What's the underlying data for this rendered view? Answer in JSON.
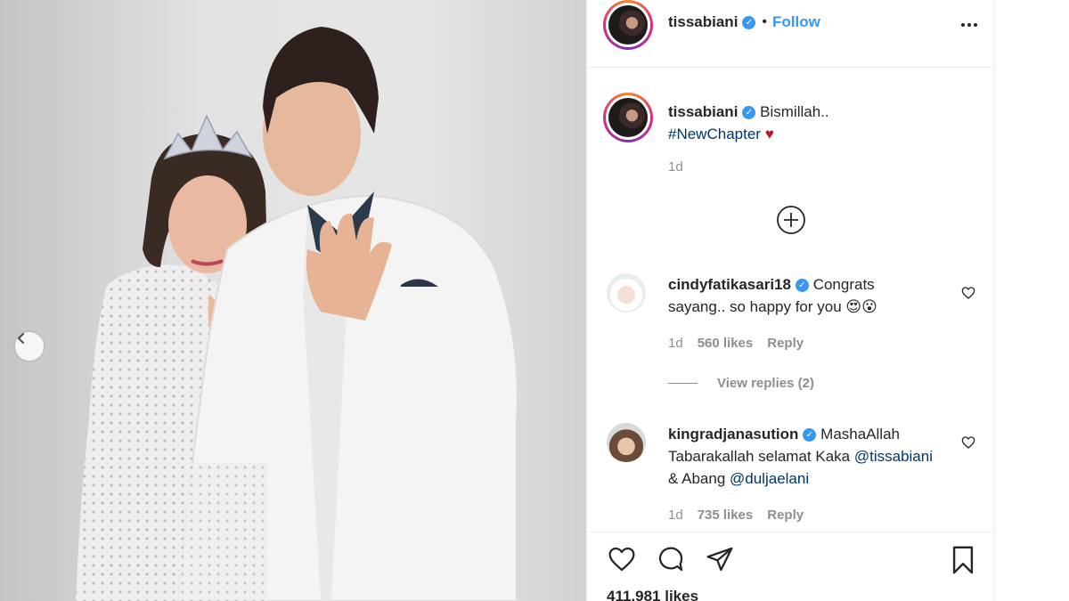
{
  "post": {
    "username": "tissabiani",
    "verified_mark": "✓",
    "separator": "•",
    "follow_label": "Follow",
    "caption_text": "Bismillah..",
    "caption_hashtag": "#NewChapter",
    "caption_emoji": "♥",
    "caption_time": "1d",
    "likes_total": "411,981 likes"
  },
  "comments": [
    {
      "username": "cindyfatikasari18",
      "text_line": "Congrats sayang.. so happy for you",
      "emoji": "😍😮",
      "time": "1d",
      "likes": "560 likes",
      "reply_label": "Reply",
      "view_replies": "View replies (2)"
    },
    {
      "username": "kingradjanasution",
      "text_part1": "MashaAllah Tabarakallah selamat Kaka",
      "mention1": "@tissabiani",
      "and_text": "& Abang",
      "mention2": "@duljaelani",
      "time": "1d",
      "likes": "735 likes",
      "reply_label": "Reply"
    }
  ],
  "icons": {
    "more": "more-options-icon",
    "load_more": "plus-circle-icon",
    "like": "heart-icon",
    "comment": "comment-icon",
    "share": "send-icon",
    "save": "bookmark-icon",
    "carousel_prev": "chevron-left-icon"
  },
  "colors": {
    "link_blue": "#3897f0",
    "hashtag_blue": "#00376b",
    "muted": "#8e8e8e",
    "heart_red": "#ed4956"
  }
}
